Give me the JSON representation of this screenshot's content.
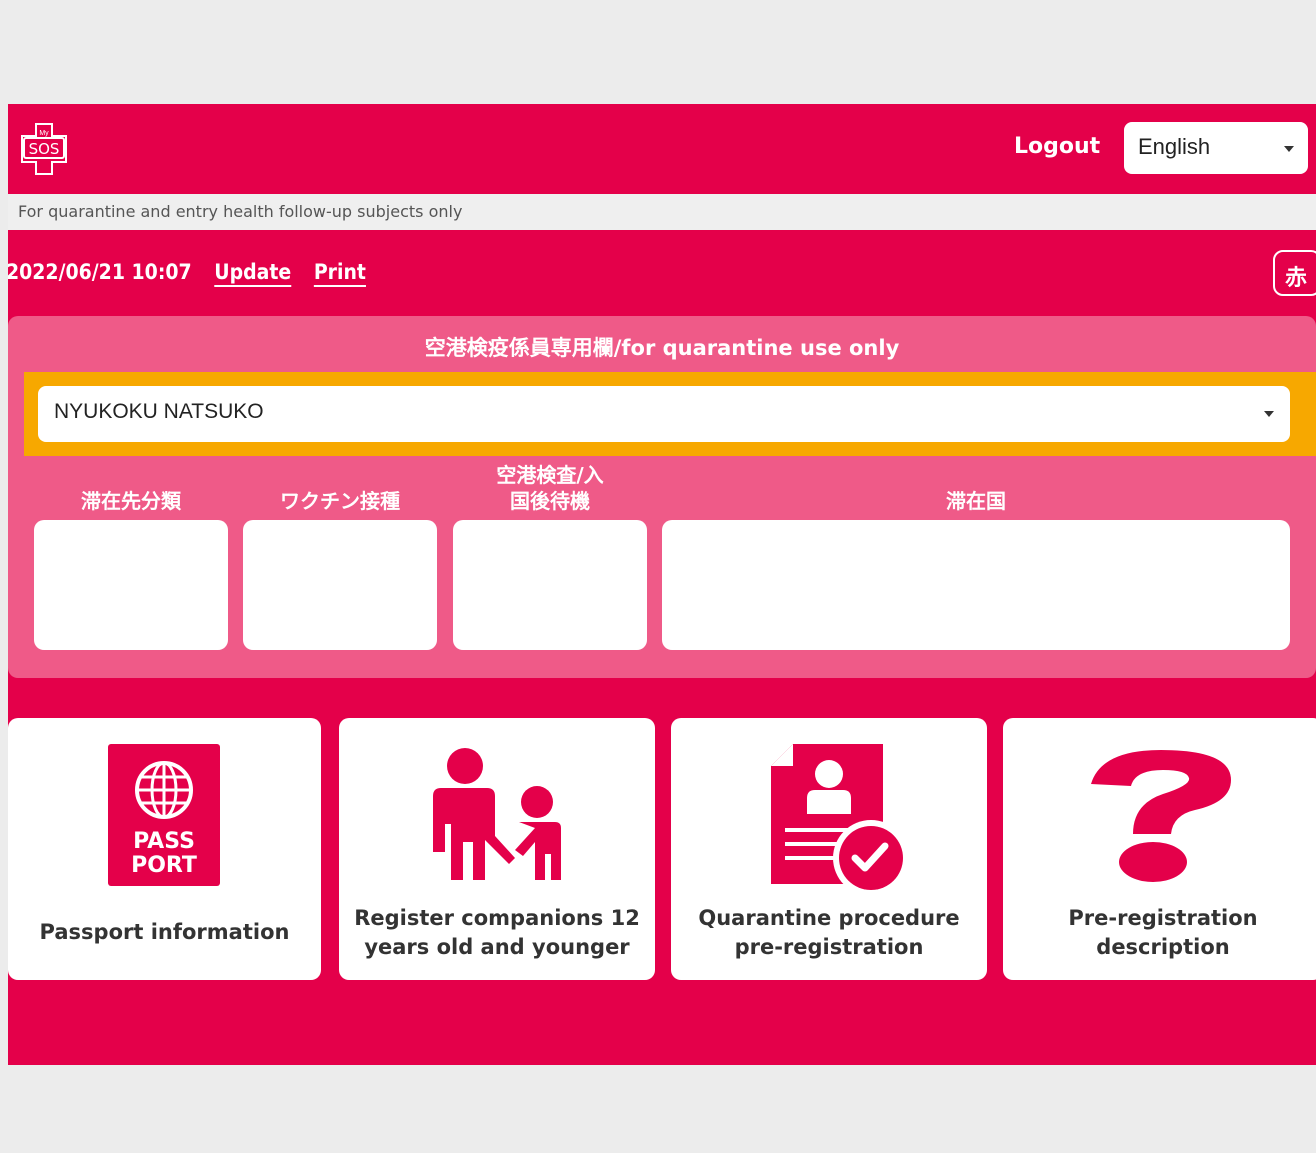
{
  "header": {
    "logo_text": "SOS",
    "logo_small": "My",
    "logout_label": "Logout",
    "language": {
      "selected": "English"
    }
  },
  "notice": "For quarantine and entry health follow-up subjects only",
  "toolbar": {
    "datetime": "2022/06/21 10:07",
    "update_label": "Update",
    "print_label": "Print",
    "red_button_label": "赤"
  },
  "quarantine_panel": {
    "title": "空港検疫係員専用欄/for quarantine use only",
    "selected_person": "NYUKOKU NATSUKO",
    "fields": [
      {
        "label": "滞在先分類",
        "value": ""
      },
      {
        "label": "ワクチン接種",
        "value": ""
      },
      {
        "label": "空港検査/入国後待機",
        "value": ""
      },
      {
        "label": "滞在国",
        "value": ""
      }
    ]
  },
  "cards": [
    {
      "line1": "Passport information",
      "line2": "",
      "icon": "passport-icon",
      "icon_text_1": "PASS",
      "icon_text_2": "PORT"
    },
    {
      "line1": "Register companions 12",
      "line2": "years old and younger",
      "icon": "parent-child-icon"
    },
    {
      "line1": "Quarantine procedure",
      "line2": "pre-registration",
      "icon": "document-check-icon"
    },
    {
      "line1": "Pre-registration",
      "line2": "description",
      "icon": "question-mark-icon"
    }
  ],
  "colors": {
    "brand_red": "#e4004a",
    "panel_pink": "#ef5a88",
    "highlight_orange": "#f7a800",
    "notice_bg": "#efefef"
  }
}
